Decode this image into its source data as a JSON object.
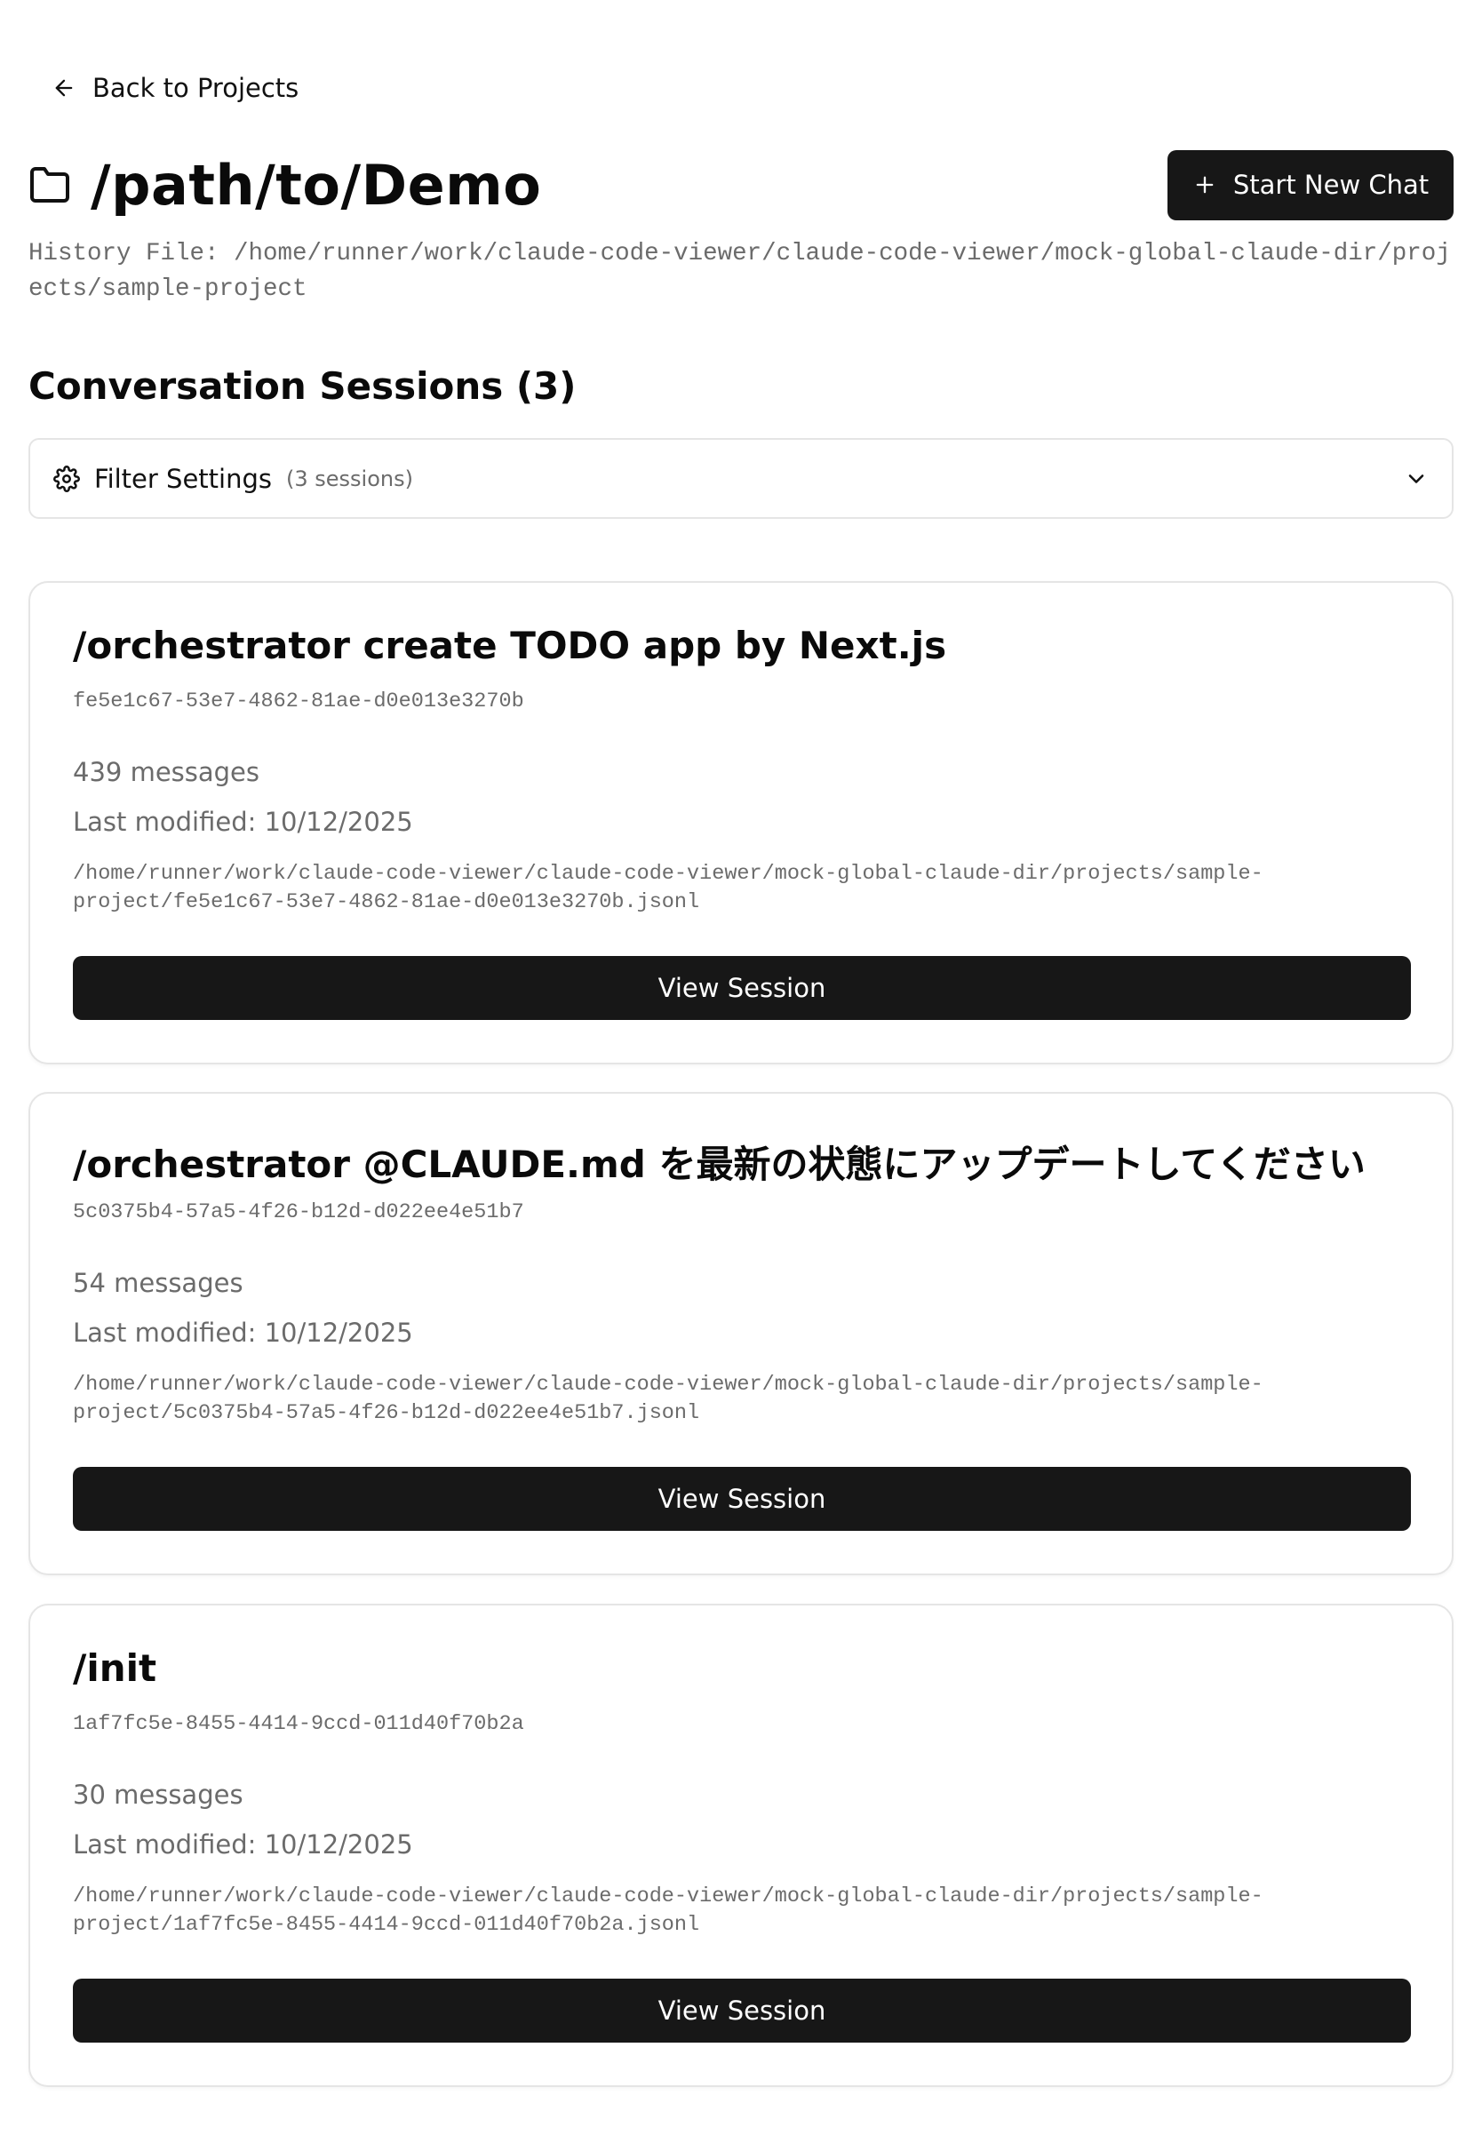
{
  "nav": {
    "back_label": "Back to Projects"
  },
  "header": {
    "title": "/path/to/Demo",
    "new_chat_label": "Start New Chat",
    "history_file": "History File: /home/runner/work/claude-code-viewer/claude-code-viewer/mock-global-claude-dir/projects/sample-project"
  },
  "sessions": {
    "heading": "Conversation Sessions (3)",
    "filter_label": "Filter Settings",
    "filter_count": "(3 sessions)",
    "items": [
      {
        "title": "/orchestrator create TODO app by Next.js",
        "id": "fe5e1c67-53e7-4862-81ae-d0e013e3270b",
        "count": "439 messages",
        "modified": "Last modified: 10/12/2025",
        "path": "/home/runner/work/claude-code-viewer/claude-code-viewer/mock-global-claude-dir/projects/sample-project/fe5e1c67-53e7-4862-81ae-d0e013e3270b.jsonl",
        "button": "View Session"
      },
      {
        "title": "/orchestrator @CLAUDE.md を最新の状態にアップデートしてください",
        "id": "5c0375b4-57a5-4f26-b12d-d022ee4e51b7",
        "count": "54 messages",
        "modified": "Last modified: 10/12/2025",
        "path": "/home/runner/work/claude-code-viewer/claude-code-viewer/mock-global-claude-dir/projects/sample-project/5c0375b4-57a5-4f26-b12d-d022ee4e51b7.jsonl",
        "button": "View Session"
      },
      {
        "title": "/init",
        "id": "1af7fc5e-8455-4414-9ccd-011d40f70b2a",
        "count": "30 messages",
        "modified": "Last modified: 10/12/2025",
        "path": "/home/runner/work/claude-code-viewer/claude-code-viewer/mock-global-claude-dir/projects/sample-project/1af7fc5e-8455-4414-9ccd-011d40f70b2a.jsonl",
        "button": "View Session"
      }
    ]
  },
  "icons": {
    "back": "arrow-left-icon",
    "folder": "folder-icon",
    "plus": "plus-icon",
    "gear": "gear-icon",
    "chevron": "chevron-down-icon"
  },
  "colors": {
    "primary_button": "#171717",
    "muted_text": "#6b6b6b",
    "border": "#e5e5e5"
  }
}
